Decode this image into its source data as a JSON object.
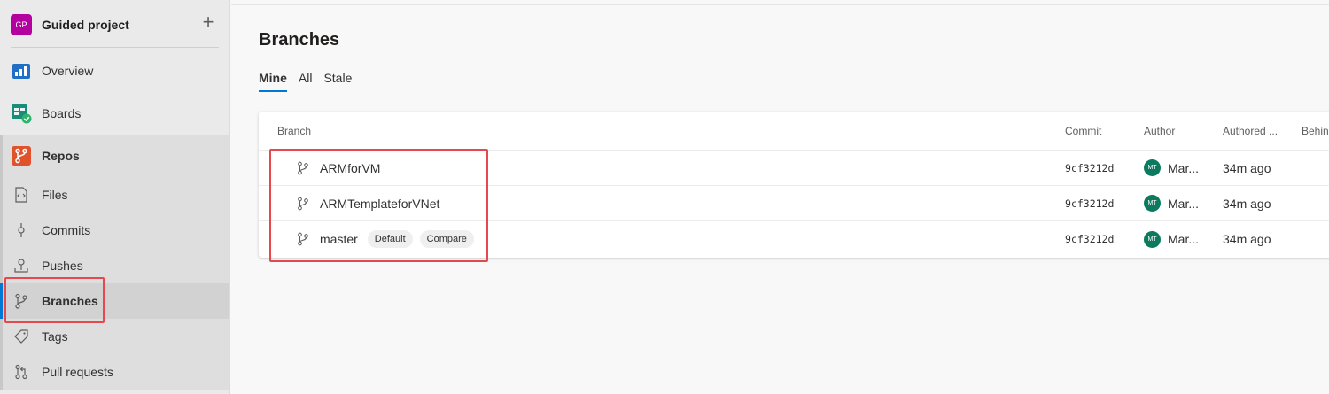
{
  "project": {
    "initials": "GP",
    "name": "Guided project",
    "add_label": "+"
  },
  "nav": {
    "overview": "Overview",
    "boards": "Boards",
    "repos": "Repos",
    "sub": [
      "Files",
      "Commits",
      "Pushes",
      "Branches",
      "Tags",
      "Pull requests"
    ]
  },
  "page": {
    "title": "Branches"
  },
  "tabs": [
    "Mine",
    "All",
    "Stale"
  ],
  "table": {
    "headers": {
      "branch": "Branch",
      "commit": "Commit",
      "author": "Author",
      "authored": "Authored ...",
      "behind": "Behin"
    },
    "rows": [
      {
        "name": "ARMforVM",
        "commit": "9cf3212d",
        "author_initials": "MT",
        "author": "Mar...",
        "date": "34m ago"
      },
      {
        "name": "ARMTemplateforVNet",
        "commit": "9cf3212d",
        "author_initials": "MT",
        "author": "Mar...",
        "date": "34m ago"
      },
      {
        "name": "master",
        "default_badge": "Default",
        "compare_label": "Compare",
        "commit": "9cf3212d",
        "author_initials": "MT",
        "author": "Mar...",
        "date": "34m ago"
      }
    ]
  },
  "colors": {
    "accent": "#0078d4",
    "highlight": "#e5484d",
    "project_avatar": "#b4009e",
    "author_avatar": "#0b7a5e"
  }
}
